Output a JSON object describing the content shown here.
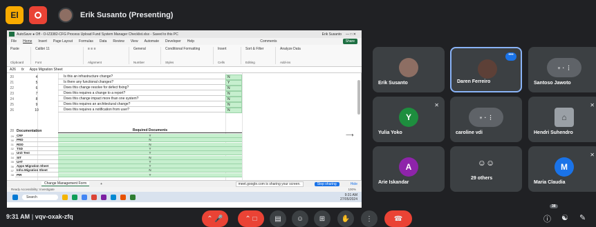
{
  "topbar": {
    "badge": "El",
    "presenting": "Erik Susanto (Presenting)"
  },
  "excel": {
    "title": "AutoSave  ● Off   -   O-IZ3382-CFG Process Upload Fund System Manager Checklist.xlsx - Saved to this PC",
    "user": "Erik Susanto",
    "menu": [
      "File",
      "Home",
      "Insert",
      "Page Layout",
      "Formulas",
      "Data",
      "Review",
      "View",
      "Automate",
      "Developer",
      "Help"
    ],
    "comments": "Comments",
    "share": "Share",
    "ribbon_groups": [
      "Clipboard",
      "Font",
      "Alignment",
      "Number",
      "Styles",
      "Cells",
      "Editing",
      "Add-ins"
    ],
    "ribbon_items": [
      "Paste",
      "Calibri 11",
      "General",
      "Conditional Formatting",
      "Insert",
      "Sort & Filter",
      "Analyze Data"
    ],
    "namebox": "A26",
    "formula": "Apps Migration Sheet",
    "rows": [
      {
        "n": "20",
        "a": "4",
        "b": "Is this an infrastructure change?",
        "c": "N"
      },
      {
        "n": "21",
        "a": "5",
        "b": "Is there any functional changes?",
        "c": "Y"
      },
      {
        "n": "22",
        "a": "6",
        "b": "Does this change resolve for defect fixing?",
        "c": "N"
      },
      {
        "n": "23",
        "a": "7",
        "b": "Does this requires a change to a report?",
        "c": "N"
      },
      {
        "n": "24",
        "a": "8",
        "b": "Does this change impact more than one system?",
        "c": "N"
      },
      {
        "n": "25",
        "a": "9",
        "b": "Does this requires an architectural change?",
        "c": "N"
      },
      {
        "n": "26",
        "a": "10",
        "b": "Does this requires a notification from user?",
        "c": "N"
      }
    ],
    "doc_header": {
      "n": "28",
      "a": "Documentation",
      "b": "Required Documents"
    },
    "docs": [
      {
        "n": "29",
        "a": "CRF",
        "b": "Y"
      },
      {
        "n": "30",
        "a": "PRD",
        "b": "N"
      },
      {
        "n": "31",
        "a": "RDD",
        "b": "N"
      },
      {
        "n": "32",
        "a": "TSD",
        "b": "Y"
      },
      {
        "n": "33",
        "a": "Unit Test",
        "b": "Y"
      },
      {
        "n": "34",
        "a": "SIT",
        "b": "N"
      },
      {
        "n": "35",
        "a": "UAT",
        "b": "Y"
      },
      {
        "n": "36",
        "a": "Apps Migration Sheet",
        "b": "Y"
      },
      {
        "n": "37",
        "a": "Infra Migration Sheet",
        "b": "N"
      },
      {
        "n": "38",
        "a": "PIR",
        "b": "Y"
      }
    ],
    "sheet_tab": "Change Management Form",
    "status": "Ready    Accessibility: Investigate",
    "sharing_notice": "meet.google.com is sharing your screen.",
    "stop_sharing": "Stop sharing",
    "hide": "Hide",
    "search": "Search",
    "clock": "9:31 AM",
    "date": "27/05/2024",
    "zoom": "100%"
  },
  "participants": [
    {
      "name": "Erik Susanto",
      "initial": "",
      "color": "#8d6e63"
    },
    {
      "name": "Daren Ferreiro",
      "initial": "",
      "color": "#5d4037"
    },
    {
      "name": "Santoso Jawoto",
      "initial": "",
      "color": "#3c4043"
    },
    {
      "name": "Yulia Yoko",
      "initial": "Y",
      "color": "#1e8e3e"
    },
    {
      "name": "caroline vdi",
      "initial": "",
      "color": "#3c4043"
    },
    {
      "name": "Hendri Suhendro",
      "initial": "",
      "color": "#9aa0a6"
    },
    {
      "name": "Arie Iskandar",
      "initial": "A",
      "color": "#8e24aa"
    },
    {
      "name": "29 others",
      "initial": "",
      "color": "#3c4043"
    },
    {
      "name": "Maria Claudia",
      "initial": "M",
      "color": "#1a73e8"
    }
  ],
  "bottom": {
    "time": "9:31 AM",
    "meeting_code": "vqv-oxak-zfq",
    "participant_count": "38"
  }
}
